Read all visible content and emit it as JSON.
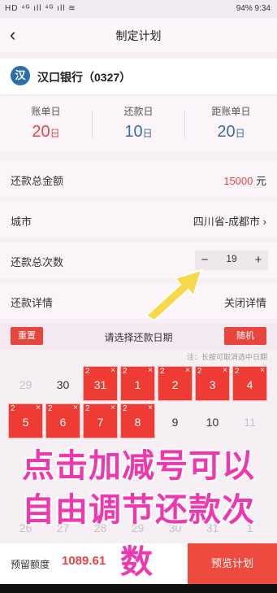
{
  "status_bar": {
    "left": "HD ⁴ᴳ ıll ⁴ᴳ ıll ≋",
    "battery": "94%",
    "time": "9:34"
  },
  "nav": {
    "title": "制定计划",
    "back": "‹"
  },
  "bank": {
    "name": "汉口银行（0327）",
    "logo_char": "汉"
  },
  "dates": [
    {
      "label": "账单日",
      "day": "20",
      "unit": "日"
    },
    {
      "label": "还款日",
      "day": "10",
      "unit": "日"
    },
    {
      "label": "距账单日",
      "day": "20",
      "unit": "日"
    }
  ],
  "rows": {
    "total_amount": {
      "label": "还款总金额",
      "value": "15000",
      "unit": " 元"
    },
    "city": {
      "label": "城市",
      "value": "四川省-成都市 ›"
    },
    "count": {
      "label": "还款总次数",
      "value": "19",
      "minus": "−",
      "plus": "+"
    },
    "details": {
      "label": "还款详情",
      "action": "关闭详情"
    }
  },
  "calendar": {
    "reset": "重置",
    "title": "请选择还款日期",
    "random": "随机",
    "note": "注：长按可取消选中日期",
    "row1": [
      {
        "n": "29",
        "state": "grey"
      },
      {
        "n": "30",
        "state": "normal"
      },
      {
        "n": "31",
        "state": "sel",
        "c": "2"
      },
      {
        "n": "1",
        "state": "sel",
        "c": "2"
      },
      {
        "n": "2",
        "state": "sel",
        "c": "2"
      },
      {
        "n": "3",
        "state": "sel",
        "c": "2"
      },
      {
        "n": "4",
        "state": "sel",
        "c": "2"
      }
    ],
    "row2": [
      {
        "n": "5",
        "state": "sel",
        "c": "2"
      },
      {
        "n": "6",
        "state": "sel",
        "c": "2"
      },
      {
        "n": "7",
        "state": "sel",
        "c": "2"
      },
      {
        "n": "8",
        "state": "sel",
        "c": "2"
      },
      {
        "n": "9",
        "state": "normal"
      },
      {
        "n": "10",
        "state": "normal"
      },
      {
        "n": "11",
        "state": "grey"
      }
    ],
    "row4": [
      {
        "n": "26",
        "state": "grey"
      },
      {
        "n": "27",
        "state": "grey"
      },
      {
        "n": "28",
        "state": "grey"
      },
      {
        "n": "29",
        "state": "grey"
      },
      {
        "n": "30",
        "state": "grey"
      },
      {
        "n": "31",
        "state": "grey"
      },
      {
        "n": "1",
        "state": "grey"
      }
    ],
    "x_mark": "×"
  },
  "overlay": {
    "line1": "点击加减号可以",
    "line2": "自由调节还款次",
    "line3": "数"
  },
  "bottom": {
    "label": "预留额度",
    "amount": "1089.61",
    "button": "预览计划"
  }
}
